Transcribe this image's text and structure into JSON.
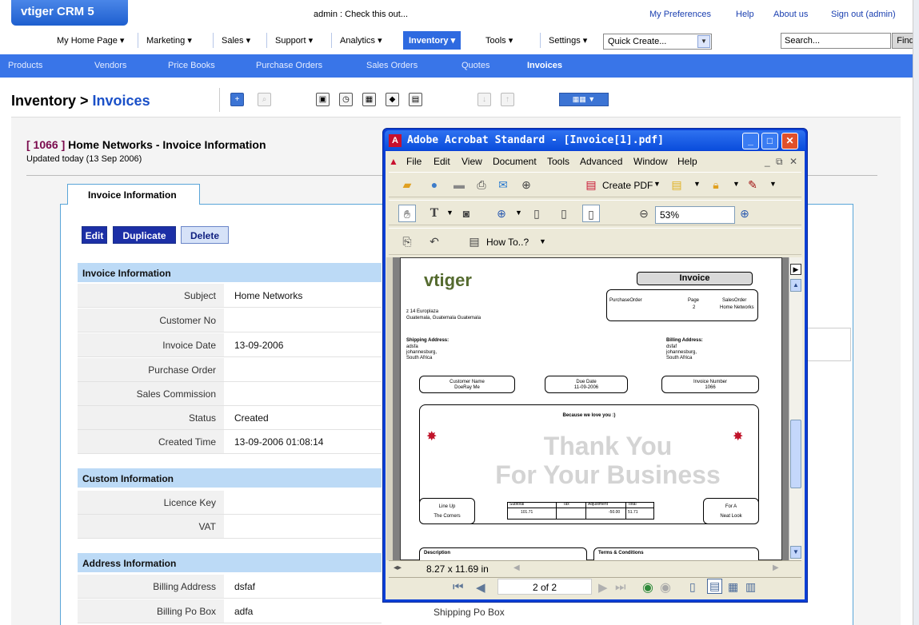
{
  "app": {
    "logo": "vtiger CRM 5",
    "admin_message": "admin : Check this out...",
    "top_links": [
      "My Preferences",
      "Help",
      "About us",
      "Sign out (admin)"
    ]
  },
  "main_menu": [
    "My Home Page ▾",
    "Marketing ▾",
    "Sales ▾",
    "Support ▾",
    "Analytics ▾",
    "Inventory ▾",
    "Tools ▾",
    "Settings ▾"
  ],
  "quick_create": "Quick Create...",
  "search": {
    "value": "Search...",
    "find_label": "Find"
  },
  "sub_nav": [
    "Products",
    "Vendors",
    "Price Books",
    "Purchase Orders",
    "Sales Orders",
    "Quotes",
    "Invoices"
  ],
  "page": {
    "module": "Inventory >",
    "crumb": "Invoices"
  },
  "record": {
    "id": "[ 1066 ]",
    "title": "Home Networks - Invoice Information",
    "updated": "Updated today (13 Sep 2006)",
    "tab": "Invoice Information",
    "buttons": {
      "edit": "Edit",
      "duplicate": "Duplicate",
      "delete": "Delete"
    }
  },
  "sections": {
    "invoice": "Invoice Information",
    "custom": "Custom Information",
    "address": "Address Information"
  },
  "invoice_fields": [
    {
      "label": "Subject",
      "value": "Home Networks"
    },
    {
      "label": "Customer No",
      "value": ""
    },
    {
      "label": "Invoice Date",
      "value": "13-09-2006"
    },
    {
      "label": "Purchase Order",
      "value": ""
    },
    {
      "label": "Sales Commission",
      "value": ""
    },
    {
      "label": "Status",
      "value": "Created"
    },
    {
      "label": "Created Time",
      "value": "13-09-2006 01:08:14"
    }
  ],
  "custom_fields": [
    {
      "label": "Licence Key",
      "value": ""
    },
    {
      "label": "VAT",
      "value": ""
    }
  ],
  "address_fields": [
    {
      "label": "Billing Address",
      "value": "dsfaf"
    },
    {
      "label": "Billing Po Box",
      "value": "adfa"
    }
  ],
  "shipping_po_label": "Shipping Po Box",
  "acrobat": {
    "title": "Adobe Acrobat Standard - [Invoice[1].pdf]",
    "menus": [
      "File",
      "Edit",
      "View",
      "Document",
      "Tools",
      "Advanced",
      "Window",
      "Help"
    ],
    "create_pdf": "Create PDF",
    "how_to": "How To..?",
    "zoom": "53%",
    "page_size": "8.27 x 11.69 in",
    "page_indicator": "2 of 2"
  },
  "pdf": {
    "logo": "vtiger",
    "title": "Invoice",
    "col_headers": {
      "po": "PurchaseOrder",
      "page": "Page",
      "so": "SalesOrder"
    },
    "page_no": "2",
    "sales_order": "Home Networks",
    "address_line1": "z 14 Europlaza",
    "address_line2": "Guatemala, Guatemala Guatemala",
    "shipping": {
      "label": "Shipping Address:",
      "lines": [
        "adsfa",
        "johannesburg,",
        "South Africa"
      ]
    },
    "billing": {
      "label": "Billing Address:",
      "lines": [
        "dsfaf",
        "johannesburg,",
        "South Africa"
      ]
    },
    "customer_name_label": "Customer Name",
    "customer_name": "DoeRay Me",
    "due_date_label": "Due Date",
    "due_date": "11-09-2006",
    "invoice_number_label": "Invoice Number",
    "invoice_number": "1066",
    "tagline": "Because we love you :)",
    "watermark_1": "Thank You",
    "watermark_2": "For Your Business",
    "line_up_label": "Line Up",
    "line_up_value": "The Corners",
    "totals_headers": [
      "Subtotal",
      "Tax",
      "Adjustment",
      "Total"
    ],
    "totals_values": [
      "101.71",
      "",
      "-50.00",
      "51.71"
    ],
    "for_a_label": "For A",
    "for_a_value": "Neat Look",
    "description_label": "Description",
    "terms_label": "Terms & Conditions"
  }
}
